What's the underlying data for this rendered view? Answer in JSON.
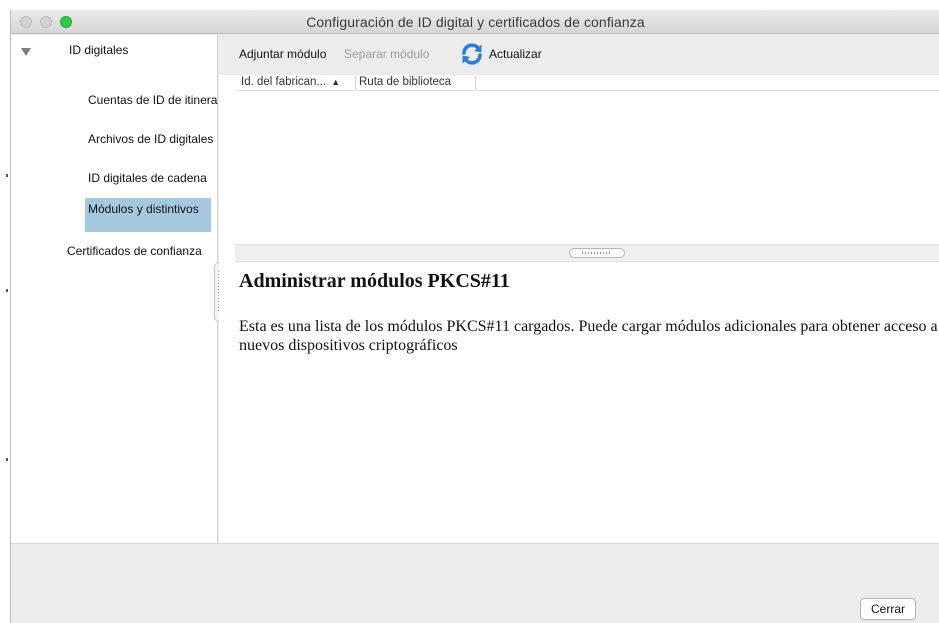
{
  "window": {
    "title": "Configuración de ID digital y certificados de confianza"
  },
  "sidebar": {
    "items": [
      {
        "label": "ID digitales"
      },
      {
        "label": "Cuentas de ID de itinerancia"
      },
      {
        "label": "Archivos de ID digitales"
      },
      {
        "label": "ID digitales de cadena"
      },
      {
        "label": "Módulos y distintivos"
      },
      {
        "label": "Certificados de confianza"
      }
    ],
    "selected": "Módulos y distintivos"
  },
  "toolbar": {
    "attach_label": "Adjuntar módulo",
    "detach_label": "Separar módulo",
    "refresh_label": "Actualizar"
  },
  "table": {
    "columns": [
      {
        "label": "Id. del fabrican..."
      },
      {
        "label": "Ruta de biblioteca"
      }
    ],
    "rows": []
  },
  "description": {
    "title": "Administrar módulos PKCS#11",
    "text": "Esta es una lista de los módulos PKCS#11 cargados. Puede cargar módulos adicionales para obtener acceso a nuevos dispositivos criptográficos"
  },
  "footer": {
    "close_label": "Cerrar"
  },
  "colors": {
    "selected_bg": "#a4c8de",
    "zoom_button": "#2fc845",
    "refresh_icon": "#2a7fd4"
  }
}
